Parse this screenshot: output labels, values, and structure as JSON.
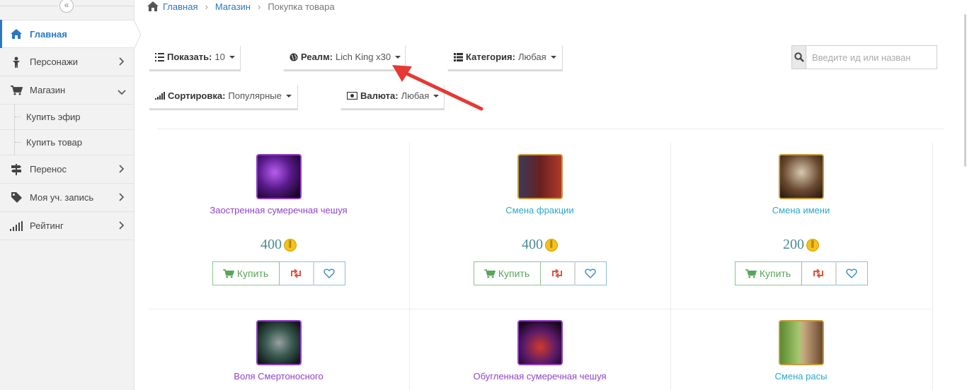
{
  "sidebar": {
    "collapse_icon": "«",
    "items": [
      {
        "label": "Главная",
        "icon": "home-icon",
        "active": true
      },
      {
        "label": "Персонажи",
        "icon": "character-icon",
        "chevron": "right"
      },
      {
        "label": "Магазин",
        "icon": "cart-icon",
        "chevron": "down"
      },
      {
        "label": "Купить эфир"
      },
      {
        "label": "Купить товар"
      },
      {
        "label": "Перенос",
        "icon": "signpost-icon",
        "chevron": "right"
      },
      {
        "label": "Моя уч. запись",
        "icon": "tag-icon",
        "chevron": "right"
      },
      {
        "label": "Рейтинг",
        "icon": "signal-icon",
        "chevron": "right"
      }
    ]
  },
  "breadcrumb": {
    "home": "Главная",
    "shop": "Магазин",
    "current": "Покупка товара"
  },
  "filters": {
    "show": {
      "label": "Показать:",
      "value": "10"
    },
    "realm": {
      "label": "Реалм:",
      "value": "Lich King x30"
    },
    "category": {
      "label": "Категория:",
      "value": "Любая"
    },
    "sort": {
      "label": "Сортировка:",
      "value": "Популярные"
    },
    "currency": {
      "label": "Валюта:",
      "value": "Любая"
    }
  },
  "search": {
    "placeholder": "Введите ид или назван"
  },
  "buttons": {
    "buy": "Купить"
  },
  "products": [
    {
      "name": "Заостренная сумеречная чешуя",
      "price": "400",
      "name_color": "#8e44c8"
    },
    {
      "name": "Смена фракции",
      "price": "400",
      "name_color": "#2ba8c8"
    },
    {
      "name": "Смена имени",
      "price": "200",
      "name_color": "#2ba8c8"
    },
    {
      "name": "Воля Смертоносного",
      "price": "",
      "name_color": "#8e44c8"
    },
    {
      "name": "Обугленная сумеречная чешуя",
      "price": "",
      "name_color": "#8e44c8"
    },
    {
      "name": "Смена расы",
      "price": "",
      "name_color": "#2ba8c8"
    }
  ],
  "colors": {
    "accent": "#2a78c2",
    "annotation_arrow": "#e53935",
    "price": "#4a8a98",
    "epic": "#8e44c8",
    "service": "#2ba8c8"
  }
}
